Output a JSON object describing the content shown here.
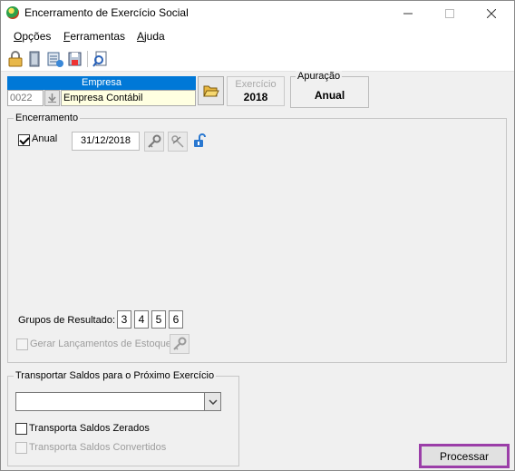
{
  "window": {
    "title": "Encerramento de Exercício Social"
  },
  "menu": {
    "items": [
      {
        "label": "Opções",
        "accel": "O",
        "rest": "pções"
      },
      {
        "label": "Ferramentas",
        "accel": "F",
        "rest": "erramentas"
      },
      {
        "label": "Ajuda",
        "accel": "A",
        "rest": "juda"
      }
    ]
  },
  "toolbar": {
    "icons": [
      "lock-icon",
      "bookmark-icon",
      "database-list-icon",
      "save-icon",
      "search-document-icon"
    ]
  },
  "empresa": {
    "header": "Empresa",
    "code": "0022",
    "name": "Empresa Contábil"
  },
  "exercicio": {
    "label": "Exercício",
    "value": "2018"
  },
  "apuracao": {
    "label": "Apuração",
    "value": "Anual"
  },
  "encerramento": {
    "legend": "Encerramento",
    "anual_label": "Anual",
    "anual_checked": true,
    "date": "31/12/2018",
    "grupos_label": "Grupos de Resultado:",
    "grupos": [
      "3",
      "4",
      "5",
      "6"
    ],
    "gerar_label": "Gerar Lançamentos de Estoque"
  },
  "transportar": {
    "legend": "Transportar Saldos para o Próximo Exercício",
    "combo_value": "",
    "zerados_label": "Transporta Saldos Zerados",
    "convertidos_label": "Transporta Saldos Convertidos"
  },
  "actions": {
    "processar_label": "Processar"
  },
  "colors": {
    "accent": "#0078d7",
    "highlight": "#9b3ea8",
    "input_yellow": "#ffffe1"
  }
}
